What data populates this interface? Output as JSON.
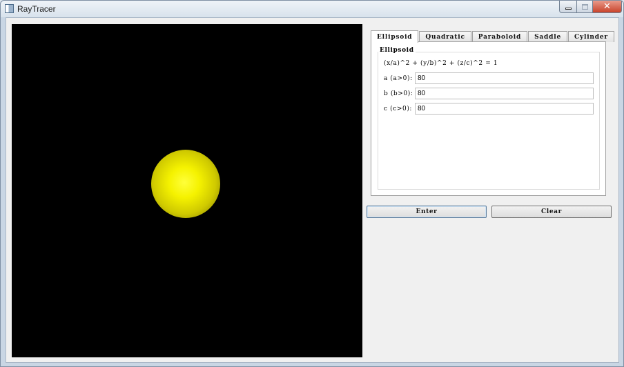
{
  "window": {
    "title": "RayTracer",
    "controls": [
      "minimize-icon",
      "maximize-icon",
      "close-icon"
    ],
    "close_glyph": "✕"
  },
  "render_view": {
    "background": "#000000",
    "sphere_color": "#f5f200"
  },
  "tabs": [
    {
      "label": "Ellipsoid",
      "active": true
    },
    {
      "label": "Quadratic",
      "active": false
    },
    {
      "label": "Paraboloid",
      "active": false
    },
    {
      "label": "Saddle",
      "active": false
    },
    {
      "label": "Cylinder",
      "active": false
    }
  ],
  "ellipsoid": {
    "group_title": "Ellipsoid",
    "formula": "(x/a)^2 + (y/b)^2 + (z/c)^2 = 1",
    "params": [
      {
        "label": "a (a>0):",
        "value": "80"
      },
      {
        "label": "b (b>0):",
        "value": "80"
      },
      {
        "label": "c (c>0):",
        "value": "80"
      }
    ]
  },
  "buttons": {
    "enter": "Enter",
    "clear": "Clear"
  }
}
